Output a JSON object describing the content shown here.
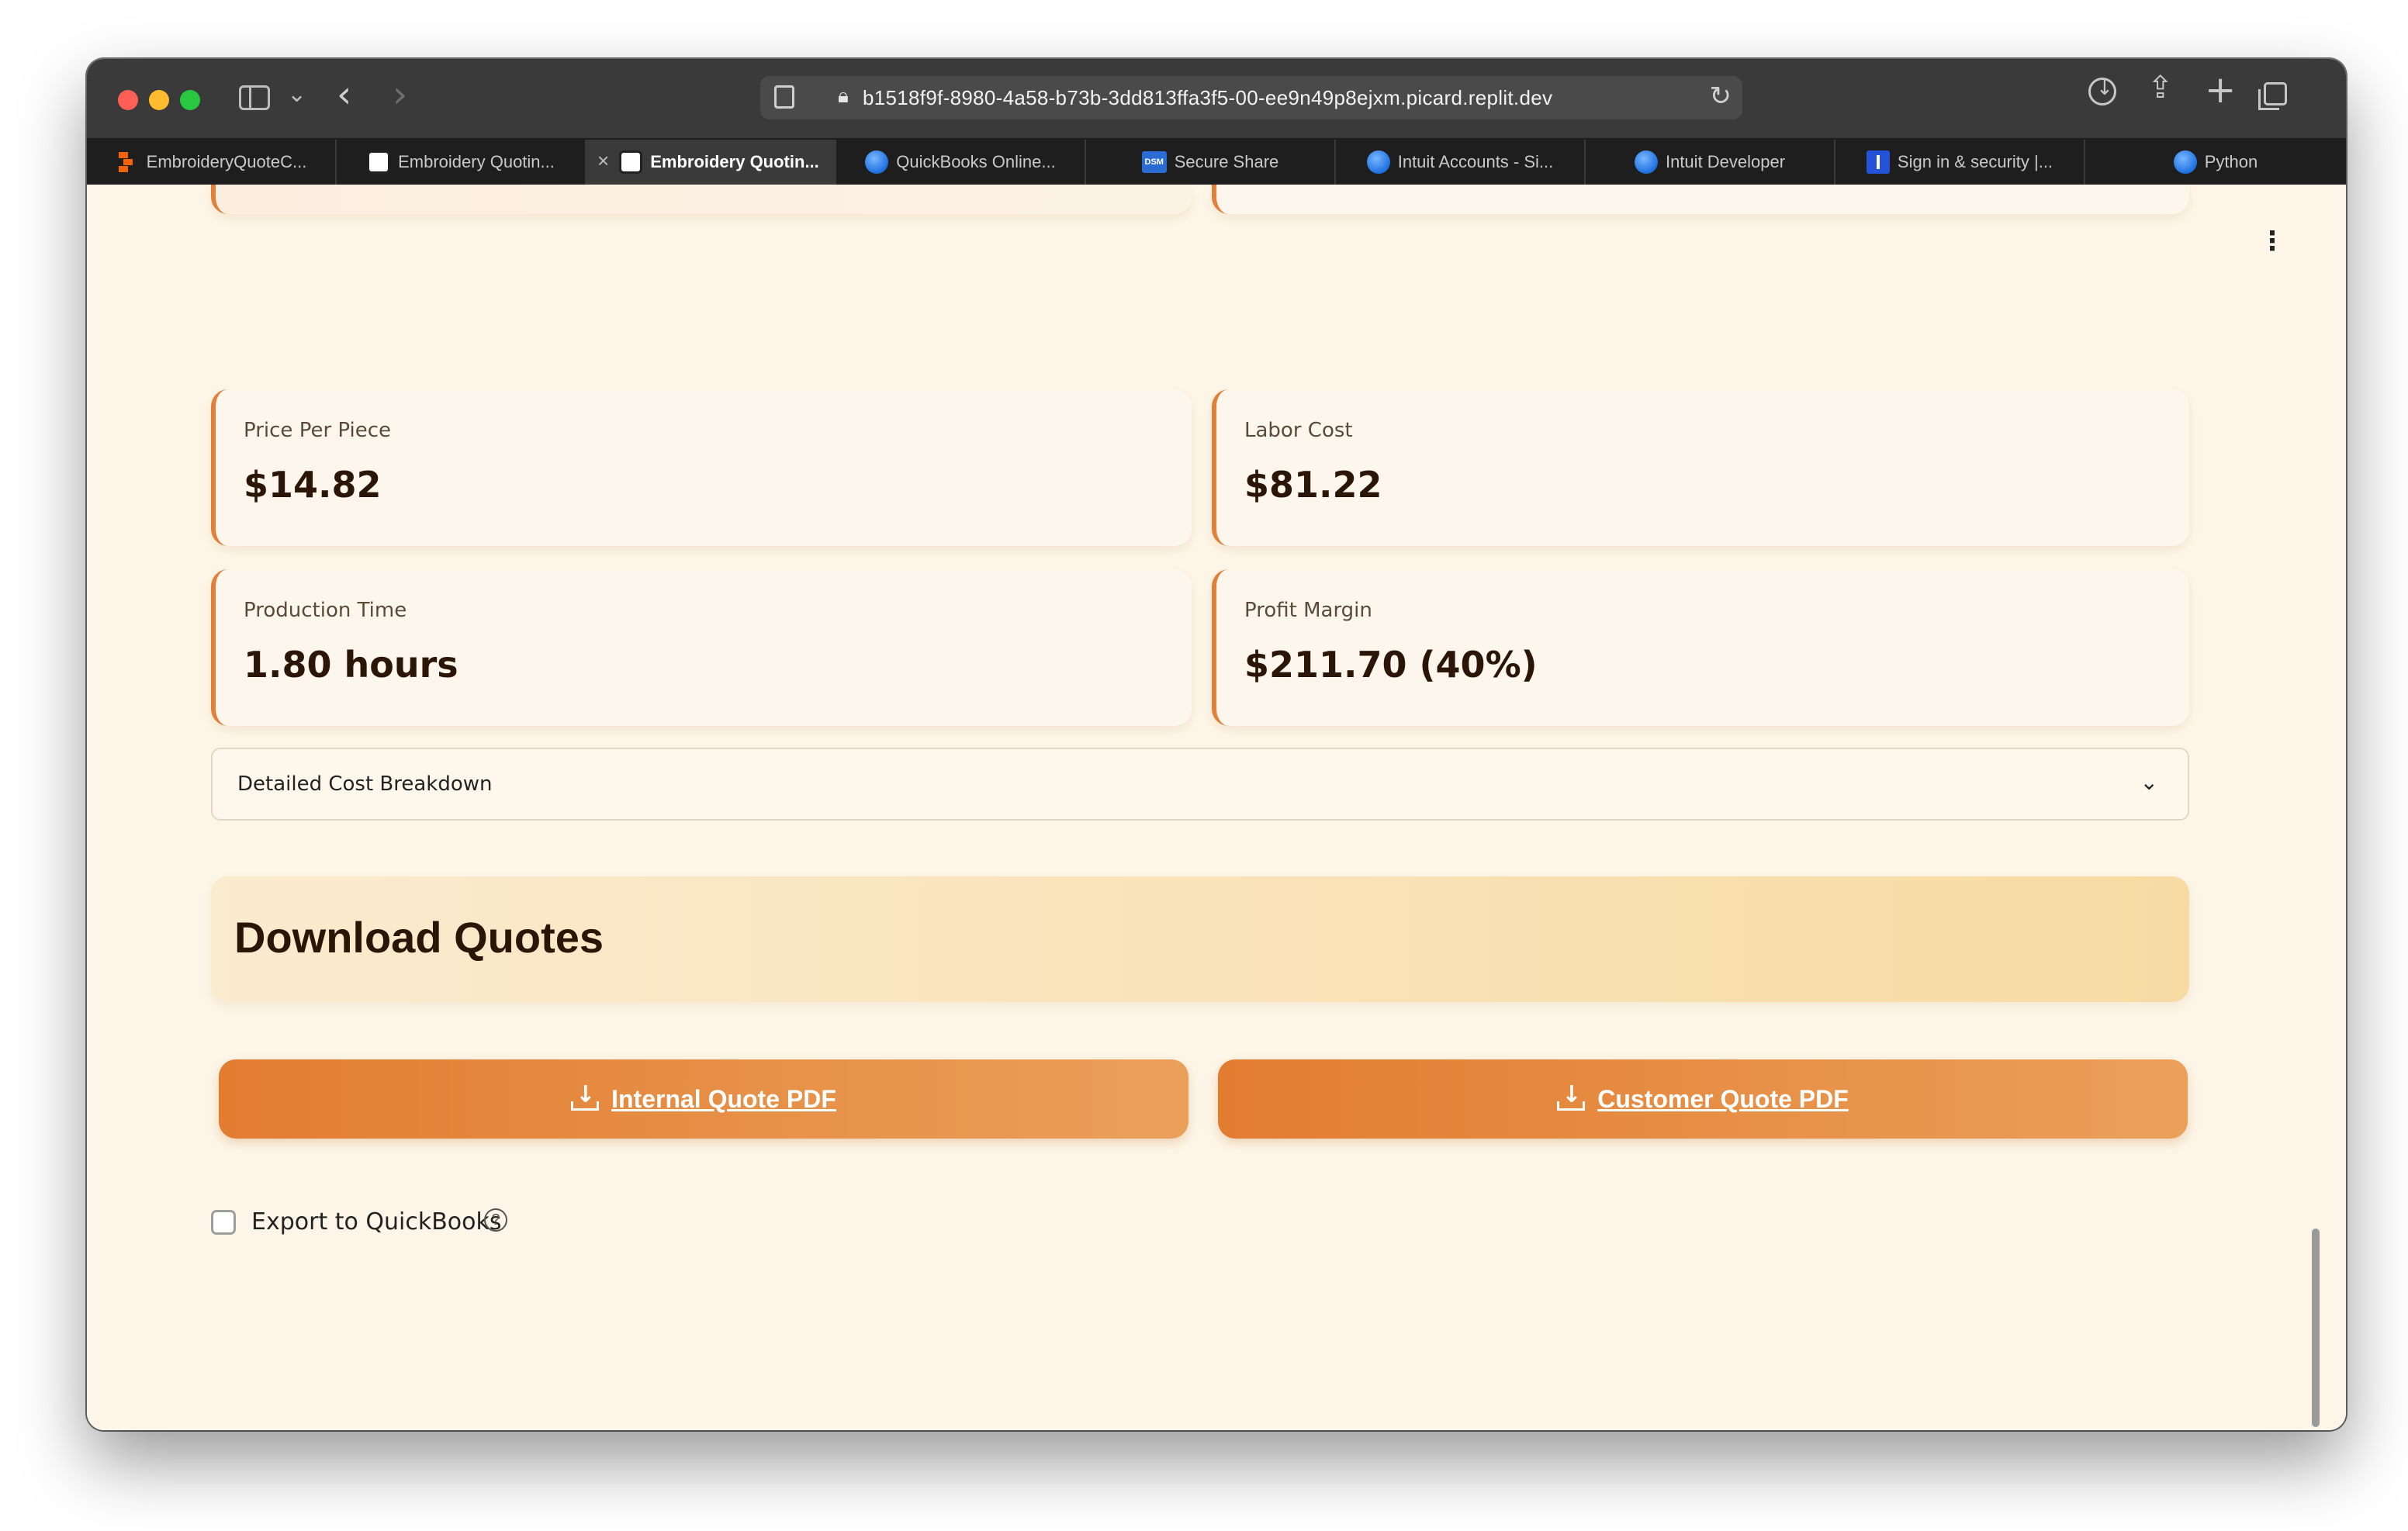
{
  "browser": {
    "url": "b1518f9f-8980-4a58-b73b-3dd813ffa3f5-00-ee9n49p8ejxm.picard.replit.dev",
    "tabs": [
      {
        "label": "EmbroideryQuoteC...",
        "icon": "replit-icon",
        "active": false
      },
      {
        "label": "Embroidery Quotin...",
        "icon": "crown-icon",
        "active": false
      },
      {
        "label": "Embroidery Quotin...",
        "icon": "crown-icon",
        "active": true
      },
      {
        "label": "QuickBooks Online...",
        "icon": "globe-icon",
        "active": false
      },
      {
        "label": "Secure Share",
        "icon": "dsm-icon",
        "active": false
      },
      {
        "label": "Intuit Accounts - Si...",
        "icon": "globe-icon",
        "active": false
      },
      {
        "label": "Intuit Developer",
        "icon": "globe-icon",
        "active": false
      },
      {
        "label": "Sign in & security |...",
        "icon": "bar-icon",
        "active": false
      },
      {
        "label": "Python",
        "icon": "globe-icon",
        "active": false
      }
    ],
    "tab_close_glyph": "×",
    "dsm_text": "DSM"
  },
  "metrics": {
    "price_per_piece": {
      "label": "Price Per Piece",
      "value": "$14.82"
    },
    "labor_cost": {
      "label": "Labor Cost",
      "value": "$81.22"
    },
    "production_time": {
      "label": "Production Time",
      "value": "1.80 hours"
    },
    "profit_margin": {
      "label": "Profit Margin",
      "value": "$211.70 (40%)"
    }
  },
  "breakdown": {
    "label": "Detailed Cost Breakdown"
  },
  "download": {
    "title": "Download Quotes",
    "internal_label": "Internal Quote PDF",
    "customer_label": "Customer Quote PDF"
  },
  "export": {
    "label": "Export to QuickBooks",
    "checked": false
  },
  "colors": {
    "accent": "#e27c30",
    "background": "#fdf6e8",
    "text": "#2a1506"
  }
}
